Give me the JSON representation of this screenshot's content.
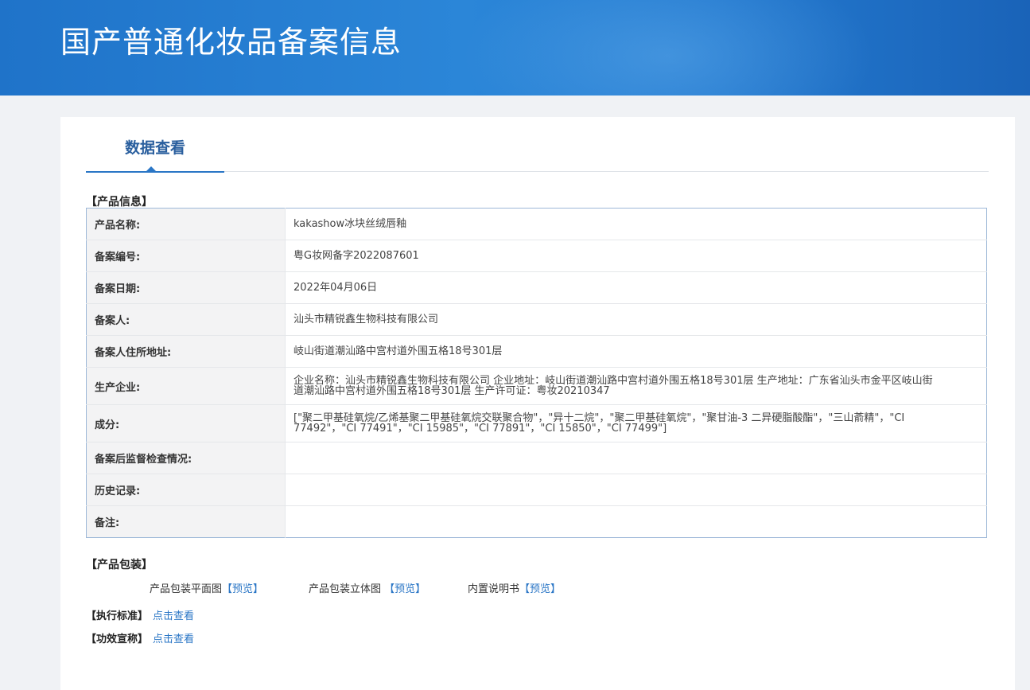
{
  "header": {
    "title": "国产普通化妆品备案信息"
  },
  "tabs": [
    {
      "label": "数据查看"
    }
  ],
  "product_info": {
    "heading": "【产品信息】",
    "rows": [
      {
        "label": "产品名称:",
        "value": "kakashow冰块丝绒唇釉"
      },
      {
        "label": "备案编号:",
        "value": "粤G妆网备字2022087601"
      },
      {
        "label": "备案日期:",
        "value": "2022年04月06日"
      },
      {
        "label": "备案人:",
        "value": "汕头市精锐鑫生物科技有限公司"
      },
      {
        "label": "备案人住所地址:",
        "value": "岐山街道潮汕路中宫村道外围五格18号301层"
      },
      {
        "label": "生产企业:",
        "value": "企业名称：汕头市精锐鑫生物科技有限公司 企业地址：岐山街道潮汕路中宫村道外围五格18号301层 生产地址：广东省汕头市金平区岐山街道潮汕路中宫村道外围五格18号301层 生产许可证：粤妆20210347"
      },
      {
        "label": "成分:",
        "value": "[\"聚二甲基硅氧烷/乙烯基聚二甲基硅氧烷交联聚合物\"，\"异十二烷\"，\"聚二甲基硅氧烷\"，\"聚甘油-3 二异硬脂酸酯\"，\"三山萮精\"，\"CI 77492\"，\"CI 77491\"，\"CI 15985\"，\"CI 77891\"，\"CI 15850\"，\"CI 77499\"]"
      },
      {
        "label": "备案后监督检查情况:",
        "value": ""
      },
      {
        "label": "历史记录:",
        "value": ""
      },
      {
        "label": "备注:",
        "value": ""
      }
    ]
  },
  "packaging": {
    "heading": "【产品包装】",
    "items": [
      {
        "label": "产品包装平面图",
        "link": "【预览】"
      },
      {
        "label": "产品包装立体图 ",
        "link": "【预览】"
      },
      {
        "label": "内置说明书",
        "link": "【预览】"
      }
    ]
  },
  "standard": {
    "heading": "【执行标准】",
    "link": "点击查看"
  },
  "claims": {
    "heading": "【功效宣称】",
    "link": "点击查看"
  }
}
